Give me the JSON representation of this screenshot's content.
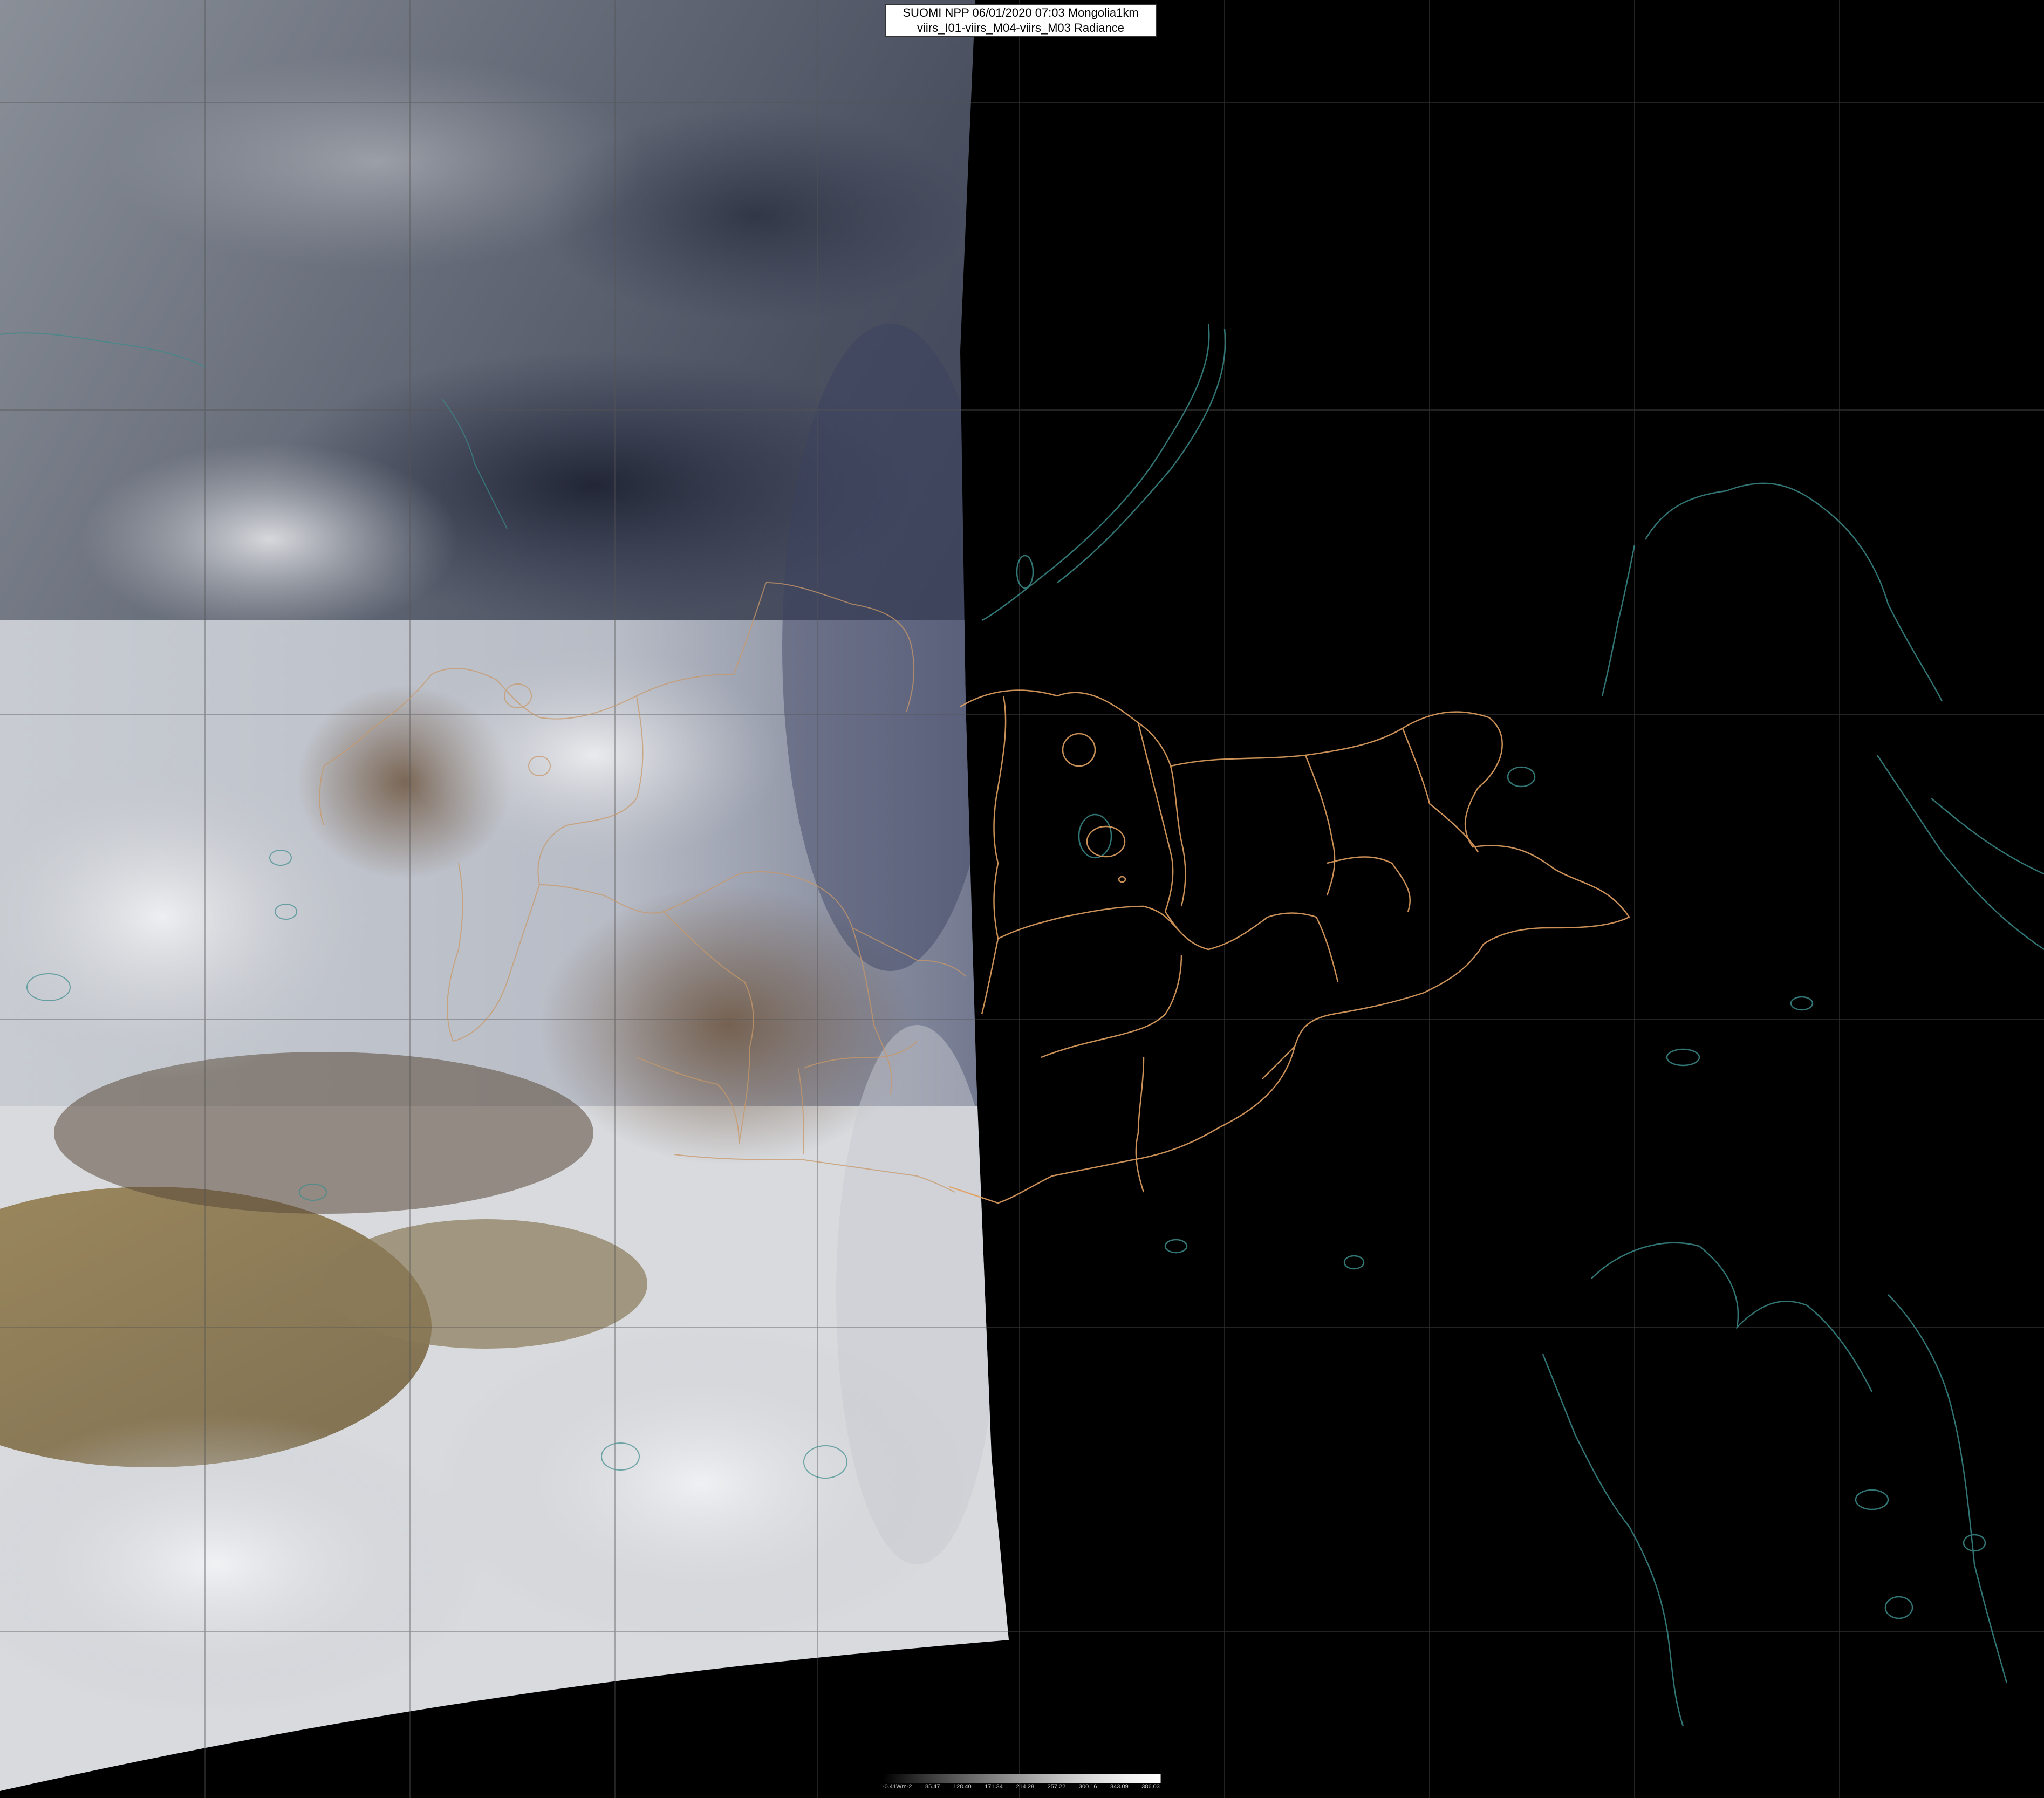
{
  "header": {
    "line1": "SUOMI NPP 06/01/2020 07:03 Mongolia1km",
    "line2": "viirs_I01-viirs_M04-viirs_M03 Radiance"
  },
  "legend": {
    "ticks": [
      "-0.41Wm-2",
      "85.47",
      "128.40",
      "171.34",
      "214.28",
      "257.22",
      "300.16",
      "343.09",
      "386.03"
    ],
    "colors": [
      "#000000",
      "#2e2e2e",
      "#555555",
      "#7a7a7a",
      "#9c9c9c",
      "#bdbdbd",
      "#d9d9d9",
      "#efefef",
      "#ffffff"
    ]
  },
  "colors": {
    "province_border": "#e0a060",
    "coastline": "#3a8a8a",
    "graticule": "#555555",
    "night_side": "#000000"
  }
}
